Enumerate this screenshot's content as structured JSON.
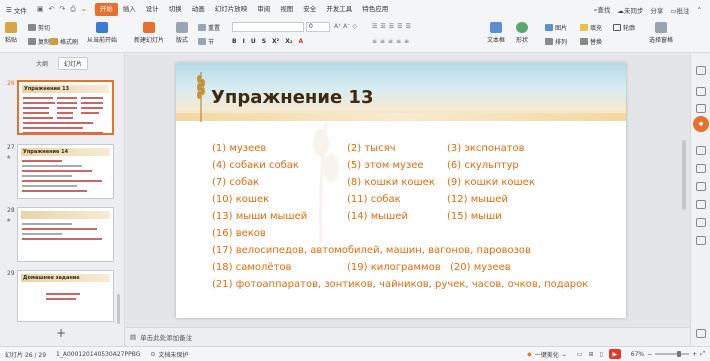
{
  "menubar": {
    "file_label": "文件",
    "tabs": [
      "开始",
      "插入",
      "设计",
      "切换",
      "动画",
      "幻灯片放映",
      "审阅",
      "视图",
      "安全",
      "开发工具",
      "特色应用"
    ],
    "search_label": "查找",
    "sync_label": "未同步",
    "share_label": "分享",
    "comment_label": "批注"
  },
  "ribbon": {
    "paste": "粘贴",
    "cut": "剪切",
    "copy": "复制",
    "format_painter": "格式刷",
    "from_current": "从当前开始",
    "new_slide": "新建幻灯片",
    "layout": "版式",
    "section": "节",
    "reset": "重置",
    "font_size": "0",
    "textbox": "文本框",
    "shape": "形状",
    "arrange": "排列",
    "picture": "图片",
    "fill": "填充",
    "outline": "轮廓",
    "replace": "替换",
    "select_pane": "选择窗格",
    "format_buttons": [
      "B",
      "I",
      "U",
      "S",
      "X²",
      "X₂",
      "A"
    ]
  },
  "leftpanel": {
    "tab_outline": "大纲",
    "tab_slides": "幻灯片",
    "thumbs": [
      {
        "num": "26",
        "title": "Упражнение 13"
      },
      {
        "num": "27",
        "title": "Упражнение 14"
      },
      {
        "num": "28",
        "title": ""
      },
      {
        "num": "29",
        "title": "Домашнее задание"
      }
    ]
  },
  "slide": {
    "title": "Упражнение 13",
    "answers": [
      "(1) музеев",
      "(2) тысяч",
      "(3) экспонатов",
      "(4) собаки собак",
      "(5) этом музее",
      "(6) скульптур",
      "(7) собак",
      "(8) кошки кошек",
      "(9) кошки кошек",
      "(10) кошек",
      "(11) собак",
      "(12) мышей",
      "(13) мыши мышей",
      "(14) мышей",
      "(15) мыши",
      "(16) веков",
      "(17) велосипедов, автомобилей, машин, вагонов, паровозов",
      "(18) самолётов",
      "(19) килограммов",
      "(20) музеев",
      "(21) фотоаппаратов, зонтиков, чайников, ручек, часов, очков, подарок"
    ]
  },
  "notes": {
    "placeholder": "单击此处添加备注"
  },
  "status": {
    "slide_counter": "幻灯片 26 / 29",
    "file_id": "1_A000120140530A27PPBG",
    "protect": "文档未保护",
    "beautify": "一键美化",
    "zoom": "67%"
  },
  "colors": {
    "accent": "#e8702a",
    "answer_text": "#e36c0a",
    "title_text": "#3b2a14"
  }
}
